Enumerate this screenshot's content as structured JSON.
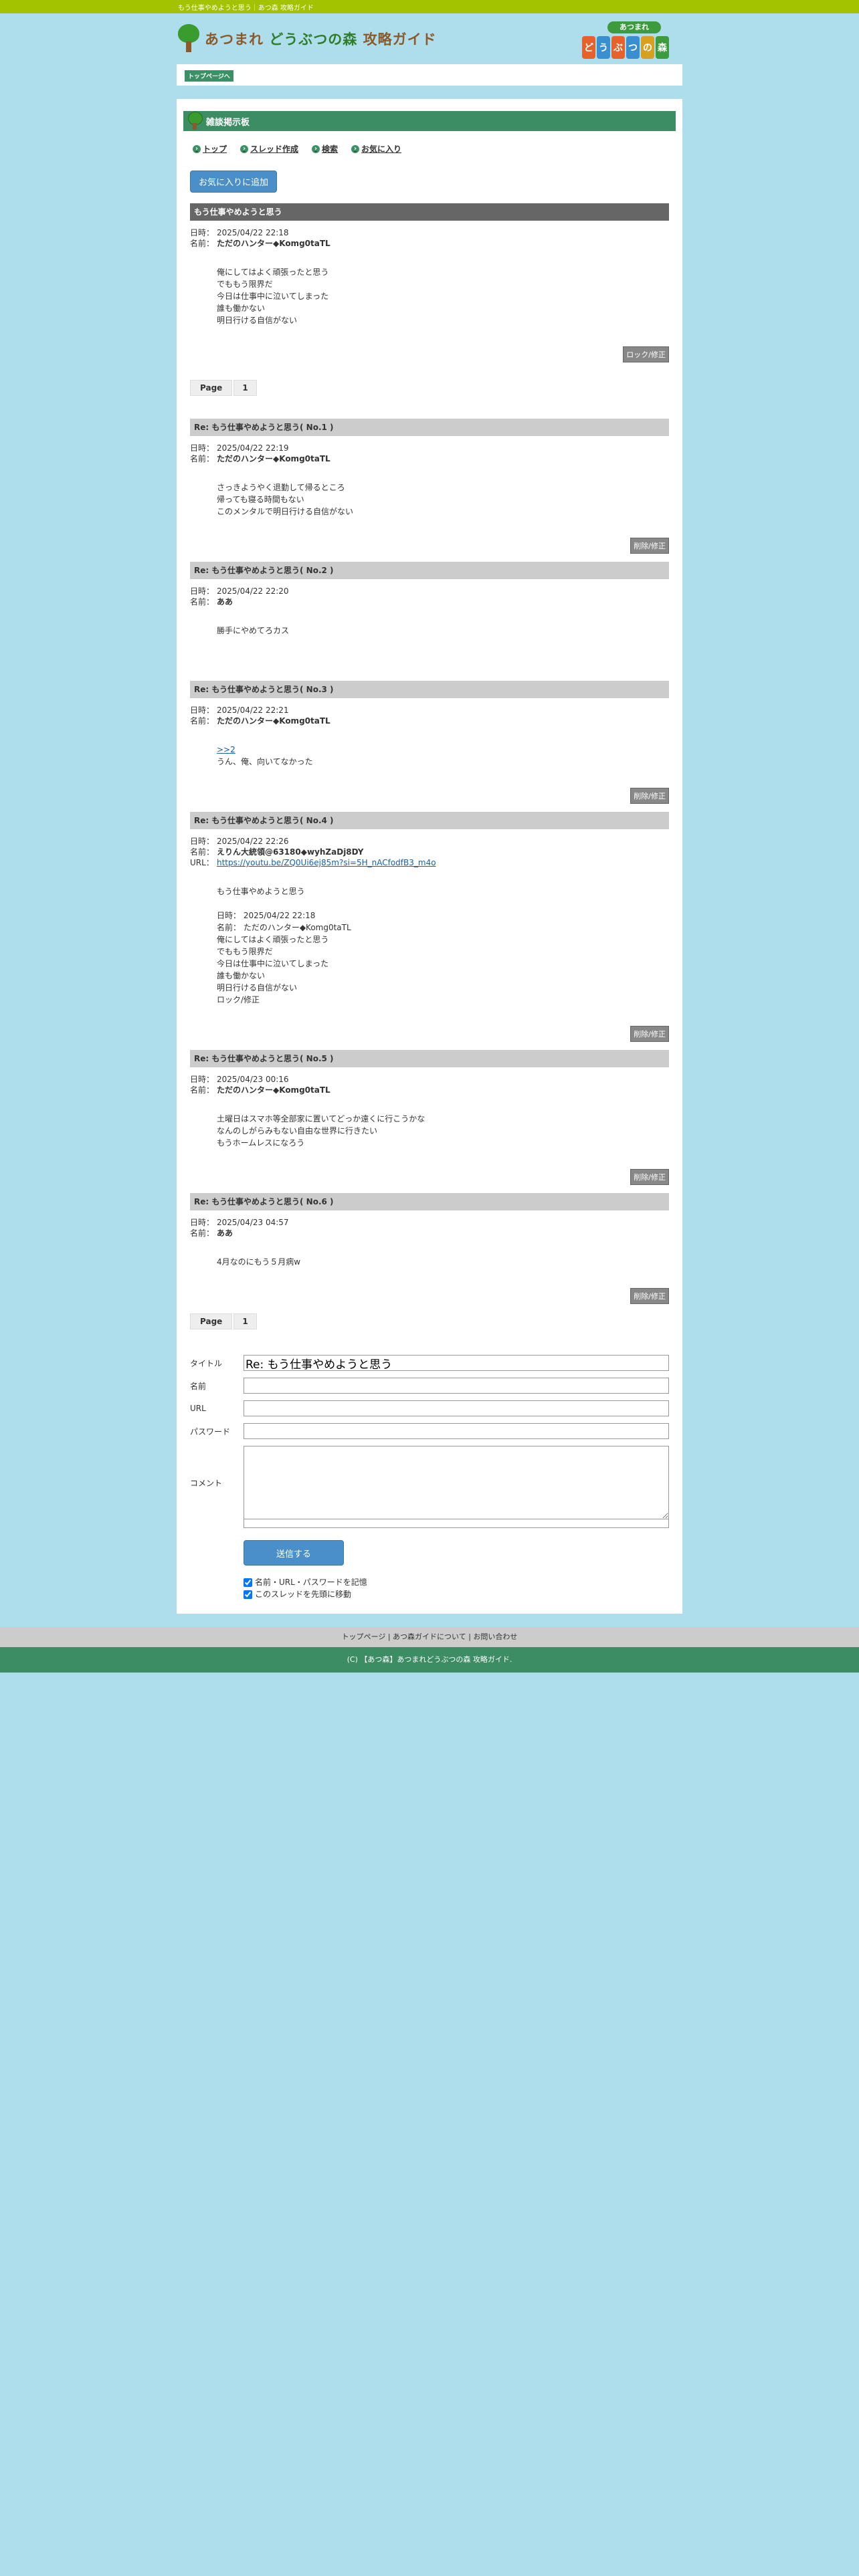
{
  "page": {
    "top_title": "もう仕事やめようと思う｜あつ森 攻略ガイド"
  },
  "header": {
    "logo_title_a": "あつまれ ",
    "logo_title_b": "どうぶつの森",
    "logo_title_c": " 攻略ガイド",
    "game_logo_top": "あつまれ",
    "game_logo_chars": [
      "ど",
      "う",
      "ぶ",
      "つ",
      "の",
      "森"
    ],
    "game_logo_colors": [
      "#e7622a",
      "#3a8fd0",
      "#e7622a",
      "#3a8fd0",
      "#d8a020",
      "#3c9b3c"
    ]
  },
  "breadcrumb": {
    "label": "トップページへ"
  },
  "board": {
    "title": "雑談掲示板"
  },
  "menu": {
    "top": "トップ",
    "new_thread": "スレッド作成",
    "search": "検索",
    "favorites": "お気に入り"
  },
  "fav_button": "お気に入りに追加",
  "labels": {
    "date": "日時：",
    "name": "名前：",
    "url": "URL："
  },
  "parent": {
    "title": "もう仕事やめようと思う",
    "date": "2025/04/22 22:18",
    "name": "ただのハンター◆Komg0taTL",
    "body": "俺にしてはよく頑張ったと思う\nでももう限界だ\n今日は仕事中に泣いてしまった\n誰も働かない\n明日行ける自信がない",
    "action": "ロック/修正"
  },
  "pager": {
    "label": "Page",
    "page": "1"
  },
  "replies": [
    {
      "title": "Re: もう仕事やめようと思う( No.1 )",
      "date": "2025/04/22 22:19",
      "name": "ただのハンター◆Komg0taTL",
      "body": "さっきようやく退勤して帰るところ\n帰っても寝る時間もない\nこのメンタルで明日行ける自信がない",
      "action": "削除/修正"
    },
    {
      "title": "Re: もう仕事やめようと思う( No.2 )",
      "date": "2025/04/22 22:20",
      "name": "ああ",
      "body": "勝手にやめてろカス",
      "action": ""
    },
    {
      "title": "Re: もう仕事やめようと思う( No.3 )",
      "date": "2025/04/22 22:21",
      "name": "ただのハンター◆Komg0taTL",
      "link": ">>2",
      "body": "うん、俺、向いてなかった",
      "action": "削除/修正"
    },
    {
      "title": "Re: もう仕事やめようと思う( No.4 )",
      "date": "2025/04/22 22:26",
      "name": "えりん大統領@63180◆wyhZaDj8DY",
      "url": "https://youtu.be/ZQ0Ui6ej85m?si=5H_nACfodfB3_m4o",
      "body": "もう仕事やめようと思う\n\n日時： 2025/04/22 22:18\n名前： ただのハンター◆Komg0taTL\n俺にしてはよく頑張ったと思う\nでももう限界だ\n今日は仕事中に泣いてしまった\n誰も働かない\n明日行ける自信がない\nロック/修正",
      "action": "削除/修正"
    },
    {
      "title": "Re: もう仕事やめようと思う( No.5 )",
      "date": "2025/04/23 00:16",
      "name": "ただのハンター◆Komg0taTL",
      "body": "土曜日はスマホ等全部家に置いてどっか遠くに行こうかな\nなんのしがらみもない自由な世界に行きたい\nもうホームレスになろう",
      "action": "削除/修正"
    },
    {
      "title": "Re: もう仕事やめようと思う( No.6 )",
      "date": "2025/04/23 04:57",
      "name": "ああ",
      "body": "4月なのにもう５月病w",
      "action": "削除/修正"
    }
  ],
  "form": {
    "title_label": "タイトル",
    "title_value": "Re: もう仕事やめようと思う",
    "name_label": "名前",
    "url_label": "URL",
    "password_label": "パスワード",
    "comment_label": "コメント",
    "submit": "送信する",
    "remember": "名前・URL・パスワードを記憶",
    "move_top": "このスレッドを先頭に移動"
  },
  "footer": {
    "link_top": "トップページ",
    "sep": " | ",
    "link_about": "あつ森ガイドについて",
    "link_contact": "お問い合わせ",
    "copyright": "(C) 【あつ森】あつまれどうぶつの森 攻略ガイド."
  }
}
